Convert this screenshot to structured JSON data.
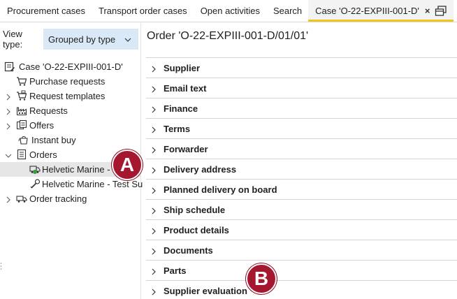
{
  "tabs": [
    {
      "label": "Procurement cases"
    },
    {
      "label": "Transport order cases"
    },
    {
      "label": "Open activities"
    },
    {
      "label": "Search"
    },
    {
      "label": "Case 'O-22-EXPIII-001-D'",
      "active": true,
      "close_glyph": "×"
    }
  ],
  "view_type": {
    "label": "View type:",
    "value": "Grouped by type"
  },
  "tree": {
    "items": [
      {
        "label": "Case 'O-22-EXPIII-001-D'",
        "icon": "case-icon"
      },
      {
        "label": "Purchase requests",
        "icon": "cart-icon"
      },
      {
        "label": "Request templates",
        "icon": "cart-template-icon"
      },
      {
        "label": "Requests",
        "icon": "factory-icon"
      },
      {
        "label": "Offers",
        "icon": "offer-icon"
      },
      {
        "label": "Instant buy",
        "icon": "instant-buy-icon"
      },
      {
        "label": "Orders",
        "icon": "orders-icon"
      },
      {
        "label": "Helvetic Marine - ",
        "icon": "order-truck-icon"
      },
      {
        "label": "Helvetic Marine - Test Su",
        "icon": "order-wrench-icon"
      },
      {
        "label": "Order tracking",
        "icon": "tracking-icon"
      }
    ]
  },
  "order": {
    "title": "Order 'O-22-EXPIII-001-D/01/01'",
    "sections": [
      {
        "label": "Supplier"
      },
      {
        "label": "Email text"
      },
      {
        "label": "Finance"
      },
      {
        "label": "Terms"
      },
      {
        "label": "Forwarder"
      },
      {
        "label": "Delivery address"
      },
      {
        "label": "Planned delivery on board"
      },
      {
        "label": "Ship schedule"
      },
      {
        "label": "Product details"
      },
      {
        "label": "Documents"
      },
      {
        "label": "Parts"
      },
      {
        "label": "Supplier evaluation"
      }
    ]
  },
  "badges": {
    "a": "A",
    "b": "B"
  },
  "colors": {
    "accent_tab": "#f0c419",
    "select_bg": "#d9e9f7",
    "badge": "#a5162f",
    "selected_row": "#e6e6e6"
  }
}
